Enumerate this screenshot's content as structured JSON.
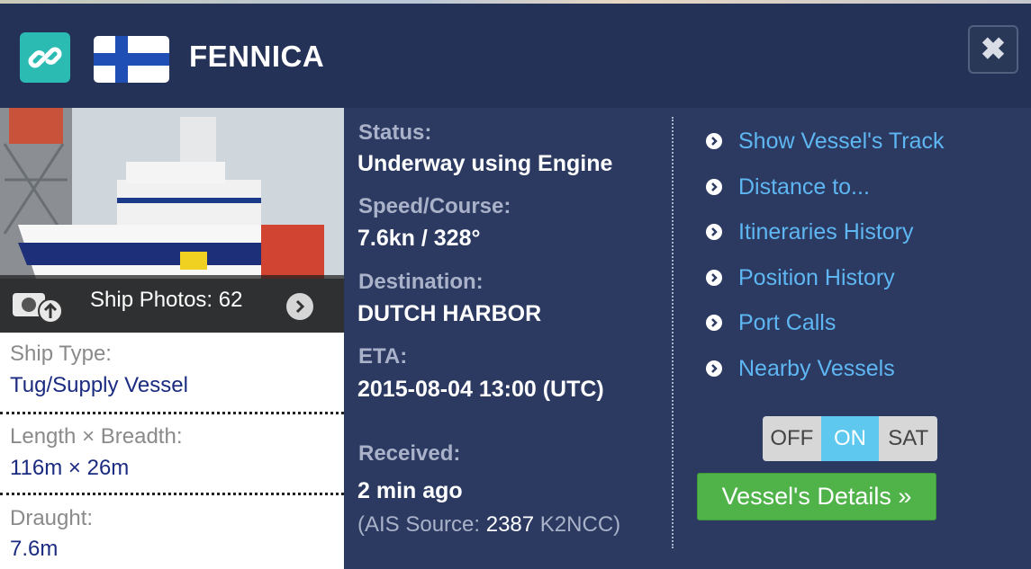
{
  "vessel": {
    "name": "FENNICA",
    "flag": "Finland"
  },
  "photo": {
    "label": "Ship Photos: 62"
  },
  "info": {
    "ship_type_label": "Ship Type:",
    "ship_type": "Tug/Supply Vessel",
    "dims_label": "Length × Breadth:",
    "dims": "116m × 26m",
    "draught_label": "Draught:",
    "draught": "7.6m"
  },
  "status": {
    "status_label": "Status:",
    "status": "Underway using Engine",
    "speed_label": "Speed/Course:",
    "speed": "7.6kn / 328°",
    "destination_label": "Destination:",
    "destination": "DUTCH HARBOR",
    "eta_label": "ETA:",
    "eta": "2015-08-04 13:00 (UTC)",
    "received_label": "Received:",
    "received": "2 min ago",
    "ais_prefix": "(AIS Source: ",
    "ais_id": "2387",
    "ais_suffix": " K2NCC)"
  },
  "links": [
    "Show Vessel's Track",
    "Distance to...",
    "Itineraries History",
    "Position History",
    "Port Calls",
    "Nearby Vessels"
  ],
  "toggle": {
    "off": "OFF",
    "on": "ON",
    "sat": "SAT",
    "selected": "ON"
  },
  "details_button": "Vessel's Details »",
  "colors": {
    "header_bg": "#243257",
    "panel_bg": "#2c3a62",
    "link": "#5eb7f2",
    "accent_teal": "#2bbbb3",
    "details_green": "#4fb34a",
    "toggle_on": "#5ec8ee"
  }
}
